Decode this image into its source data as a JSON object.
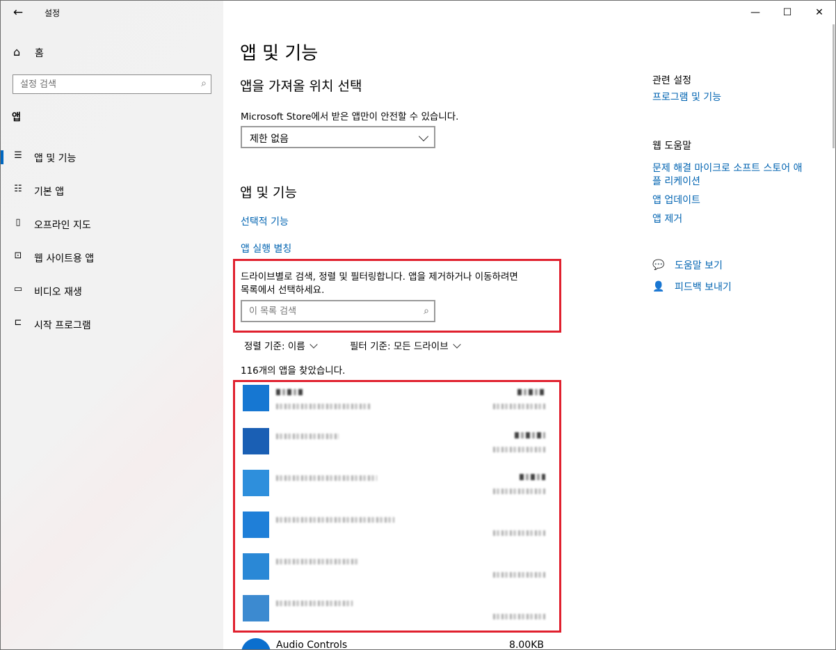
{
  "window": {
    "title": "설정",
    "controls": {
      "minimize": "—",
      "maximize": "☐",
      "close": "✕"
    }
  },
  "sidebar": {
    "home": "홈",
    "search_placeholder": "설정 검색",
    "category": "앱",
    "items": [
      {
        "label": "앱 및 기능",
        "icon": "apps-features-icon",
        "active": true
      },
      {
        "label": "기본 앱",
        "icon": "default-apps-icon"
      },
      {
        "label": "오프라인 지도",
        "icon": "offline-maps-icon"
      },
      {
        "label": "웹 사이트용 앱",
        "icon": "apps-for-websites-icon"
      },
      {
        "label": "비디오 재생",
        "icon": "video-playback-icon"
      },
      {
        "label": "시작 프로그램",
        "icon": "startup-icon"
      }
    ]
  },
  "main": {
    "title": "앱 및 기능",
    "install_section": {
      "title": "앱을 가져올 위치 선택",
      "description": "Microsoft Store에서 받은 앱만이 안전할 수 있습니다.",
      "dropdown_value": "제한 없음"
    },
    "apps_section": {
      "title": "앱 및 기능",
      "optional_features": "선택적 기능",
      "app_aliases": "앱 실행 별칭",
      "search_description_line1": "드라이브별로 검색, 정렬 및 필터링합니다. 앱을 제거하거나 이동하려면",
      "search_description_line2": "목록에서 선택하세요.",
      "search_placeholder": "이 목록 검색",
      "sort_label": "정렬 기준:",
      "sort_value": "이름",
      "filter_label": "필터 기준:",
      "filter_value": "모든 드라이브",
      "count_text": "116개의 앱을 찾았습니다.",
      "visible_app": {
        "name": "Audio Controls",
        "size": "8.00KB"
      }
    }
  },
  "right": {
    "related_title": "관련 설정",
    "programs_link": "프로그램 및 기능",
    "help_title": "웹 도움말",
    "help_link1_line1": "문제 해결 마이크로 소프트 스토어 애",
    "help_link1_line2": "플 리케이션",
    "help_link2": "앱 업데이트",
    "help_link3": "앱 제거",
    "get_help": "도움말 보기",
    "feedback": "피드백 보내기"
  },
  "colors": {
    "accent": "#0067c0",
    "link": "#0063b1",
    "highlight": "#e0202e"
  }
}
